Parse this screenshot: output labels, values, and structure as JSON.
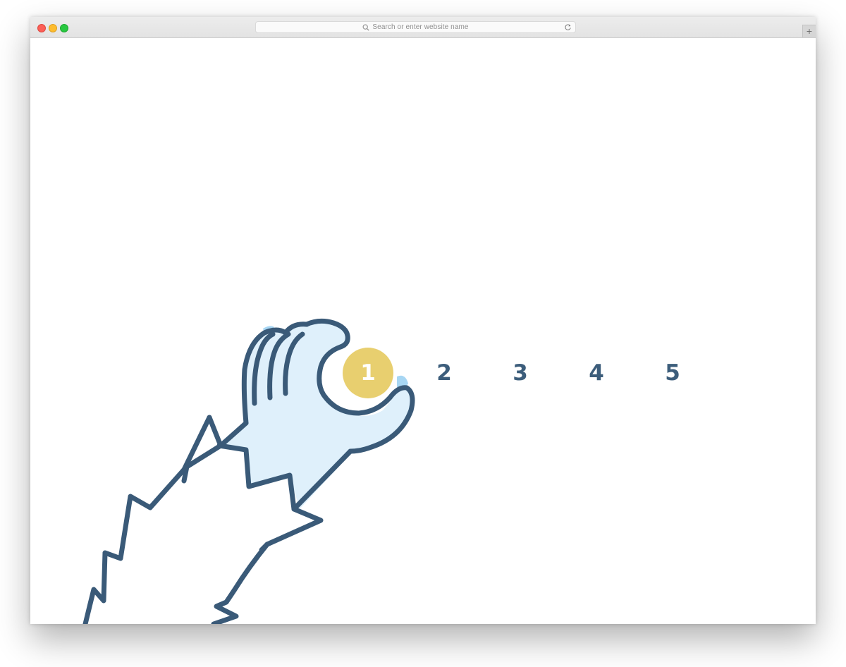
{
  "browser": {
    "url_placeholder": "Search or enter website name",
    "new_tab_symbol": "+",
    "traffic_lights": [
      "#fc5f57",
      "#fdbc2e",
      "#28c840"
    ]
  },
  "rating": {
    "items": [
      "1",
      "2",
      "3",
      "4",
      "5"
    ],
    "selected": "1",
    "accent_color": "#e8cf6f",
    "number_color": "#3c5d7b"
  },
  "illustration": {
    "subject": "furry-hand-icon",
    "stroke_color": "#3a5a78",
    "fill_color": "#dff0fb",
    "highlight_color": "#a7d6f3"
  }
}
